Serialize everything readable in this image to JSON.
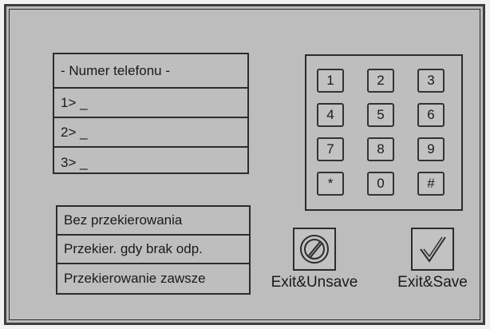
{
  "phone": {
    "header": "- Numer telefonu -",
    "entries": [
      "1> _",
      "2> _",
      "3> _"
    ]
  },
  "forwarding": {
    "options": [
      "Bez przekierowania",
      "Przekier. gdy brak odp.",
      "Przekierowanie zawsze"
    ]
  },
  "keypad": {
    "keys": [
      "1",
      "2",
      "3",
      "4",
      "5",
      "6",
      "7",
      "8",
      "9",
      "*",
      "0",
      "#"
    ]
  },
  "actions": {
    "unsave": {
      "label": "Exit&Unsave",
      "icon": "cancel-circle-slash-icon"
    },
    "save": {
      "label": "Exit&Save",
      "icon": "checkmark-icon"
    }
  },
  "colors": {
    "panel_bg": "#bdbdbd",
    "border": "#2c2c2c"
  }
}
